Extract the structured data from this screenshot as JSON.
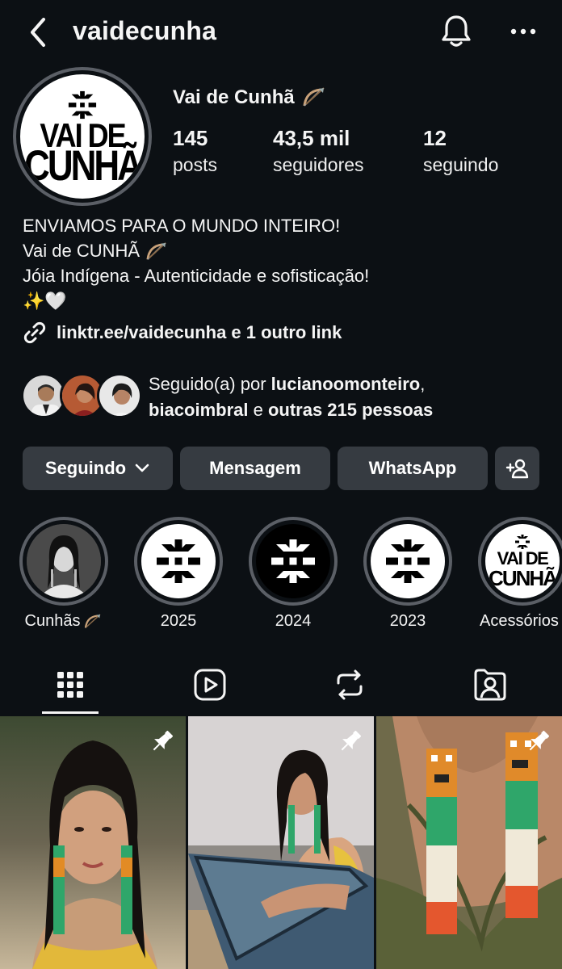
{
  "header": {
    "username": "vaidecunha"
  },
  "profile": {
    "display_name": "Vai de Cunhã",
    "logo_line1": "VAI DE",
    "logo_line2": "CUNHÃ",
    "stats": [
      {
        "value": "145",
        "label": "posts"
      },
      {
        "value": "43,5 mil",
        "label": "seguidores"
      },
      {
        "value": "12",
        "label": "seguindo"
      }
    ],
    "bio": {
      "line1": "ENVIAMOS PARA O MUNDO INTEIRO!",
      "line2": "Vai de CUNHÃ",
      "line3": "Jóia Indígena - Autenticidade e sofisticação!",
      "line4": "✨🤍"
    },
    "link": "linktr.ee/vaidecunha e 1 outro link",
    "followed_by": {
      "prefix": "Seguido(a) por ",
      "user1": "lucianoomonteiro",
      "sep": ",",
      "user2": "biacoimbral",
      "middle": " e ",
      "rest": "outras 215 pessoas"
    }
  },
  "buttons": {
    "following": "Seguindo",
    "message": "Mensagem",
    "whatsapp": "WhatsApp"
  },
  "highlights": [
    {
      "label": "Cunhãs"
    },
    {
      "label": "2025"
    },
    {
      "label": "2024"
    },
    {
      "label": "2023"
    },
    {
      "label": "Acessórios"
    }
  ],
  "icons": {
    "back": "chevron-left-icon",
    "bell": "bell-icon",
    "more": "more-horizontal-icon",
    "link": "link-icon",
    "add_person": "add-person-icon",
    "tabs": [
      "grid-icon",
      "reels-icon",
      "reposts-icon",
      "tagged-icon"
    ],
    "pin": "pin-icon"
  },
  "colors": {
    "background": "#0c1014",
    "button": "#363b41",
    "ring": "#5b5f66",
    "text": "#f5f5f5"
  }
}
